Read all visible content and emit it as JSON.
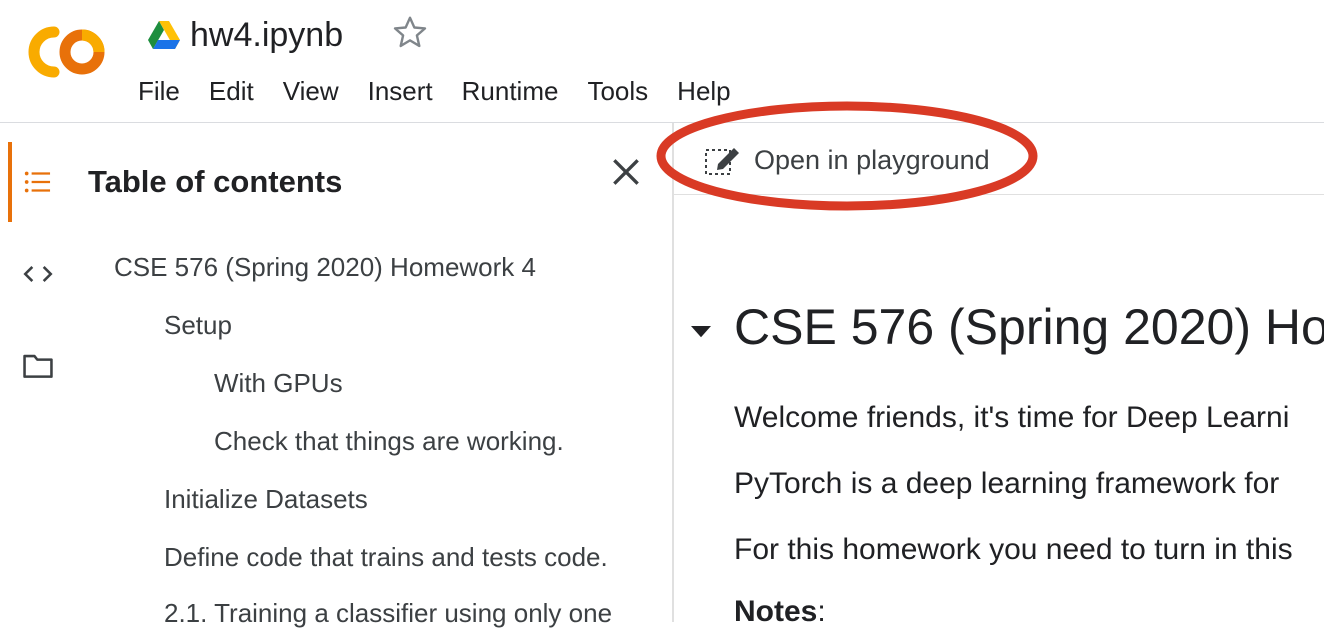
{
  "header": {
    "filename": "hw4.ipynb",
    "menu": [
      "File",
      "Edit",
      "View",
      "Insert",
      "Runtime",
      "Tools",
      "Help"
    ]
  },
  "sidebar": {
    "icons": [
      "table-of-contents-icon",
      "code-snippets-icon",
      "files-folder-icon"
    ],
    "active": "table-of-contents-icon"
  },
  "toc": {
    "title": "Table of contents",
    "items": [
      {
        "label": "CSE 576 (Spring 2020) Homework 4",
        "level": 1
      },
      {
        "label": "Setup",
        "level": 2
      },
      {
        "label": "With GPUs",
        "level": 3
      },
      {
        "label": "Check that things are working.",
        "level": 3
      },
      {
        "label": "Initialize Datasets",
        "level": 2
      },
      {
        "label": "Define code that trains and tests code.",
        "level": 2
      },
      {
        "label": "2.1. Training a classifier using only one",
        "level": 2
      }
    ]
  },
  "toolbar": {
    "playground_label": "Open in playground"
  },
  "notebook": {
    "heading": "CSE 576 (Spring 2020) Ho",
    "paragraphs": [
      "Welcome friends, it's time for Deep Learni",
      "PyTorch is a deep learning framework for",
      "For this homework you need to turn in this"
    ],
    "notes_label": "Notes",
    "notes_suffix": ":"
  },
  "colors": {
    "logo_orange": "#F9AB00",
    "logo_dark_orange": "#E8710A",
    "highlight_red": "#D93A25",
    "text": "#202124"
  }
}
